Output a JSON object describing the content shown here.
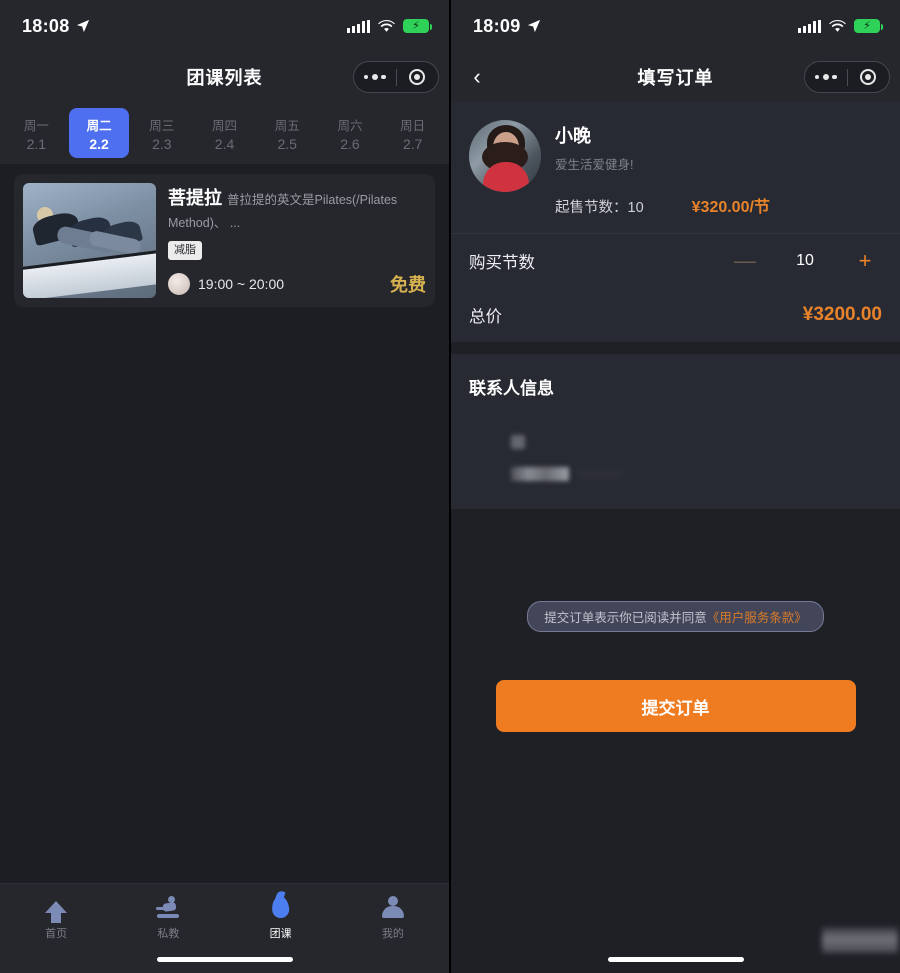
{
  "left": {
    "status": {
      "time": "18:08",
      "location_icon": "location-arrow-icon",
      "signal_icon": "signal-bars-icon",
      "wifi_icon": "wifi-icon",
      "battery_icon": "battery-charging-icon"
    },
    "nav": {
      "title": "团课列表",
      "more_icon": "more-dots-icon",
      "target_icon": "target-circle-icon"
    },
    "dates": [
      {
        "weekday": "周一",
        "date": "2.1",
        "active": false
      },
      {
        "weekday": "周二",
        "date": "2.2",
        "active": true
      },
      {
        "weekday": "周三",
        "date": "2.3",
        "active": false
      },
      {
        "weekday": "周四",
        "date": "2.4",
        "active": false
      },
      {
        "weekday": "周五",
        "date": "2.5",
        "active": false
      },
      {
        "weekday": "周六",
        "date": "2.6",
        "active": false
      },
      {
        "weekday": "周日",
        "date": "2.7",
        "active": false
      }
    ],
    "course": {
      "title": "菩提拉",
      "desc": "普拉提的英文是Pilates(/Pilates Method)、 ...",
      "tag": "减脂",
      "time": "19:00 ~ 20:00",
      "price": "免费",
      "thumb_alt": "pilates-reformer-class-photo"
    },
    "tabs": [
      {
        "label": "首页",
        "icon": "home-icon",
        "active": false
      },
      {
        "label": "私教",
        "icon": "personal-trainer-icon",
        "active": false
      },
      {
        "label": "团课",
        "icon": "flame-icon",
        "active": true
      },
      {
        "label": "我的",
        "icon": "user-icon",
        "active": false
      }
    ]
  },
  "right": {
    "status": {
      "time": "18:09",
      "location_icon": "location-arrow-icon",
      "signal_icon": "signal-bars-icon",
      "wifi_icon": "wifi-icon",
      "battery_icon": "battery-charging-icon"
    },
    "nav": {
      "title": "填写订单",
      "back_icon": "back-chevron-icon",
      "more_icon": "more-dots-icon",
      "target_icon": "target-circle-icon"
    },
    "trainer": {
      "avatar_alt": "trainer-portrait-photo",
      "name": "小晚",
      "slogan": "爱生活爱健身!",
      "min_sessions_label": "起售节数：10",
      "unit_price": "¥320.00/节"
    },
    "quantity": {
      "label": "购买节数",
      "minus": "—",
      "value": "10",
      "plus": "+"
    },
    "total": {
      "label": "总价",
      "value": "¥3200.00"
    },
    "contact": {
      "title": "联系人信息",
      "redacted": "（已打码）"
    },
    "terms": {
      "prefix": "提交订单表示你已阅读并同意",
      "link": "《用户服务条款》"
    },
    "submit_label": "提交订单"
  },
  "colors": {
    "accent_orange": "#f07c22",
    "accent_blue": "#4d6ff0",
    "gold": "#d6b150",
    "card_bg": "#282a33",
    "page_bg": "#1e2026",
    "battery_green": "#2fd158"
  }
}
